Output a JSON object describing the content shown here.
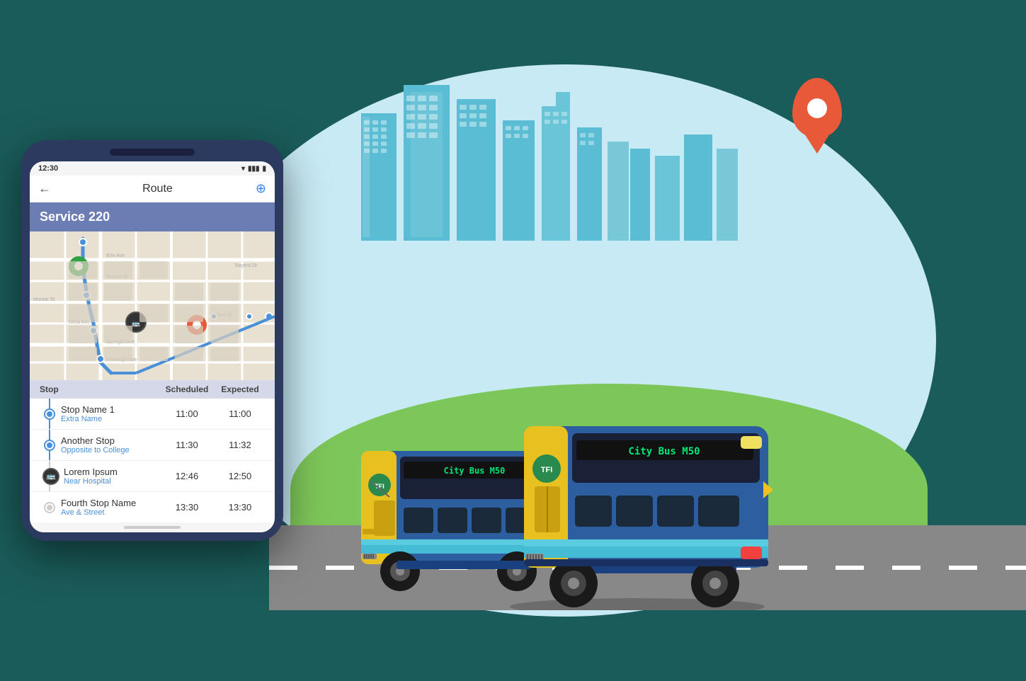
{
  "background_color": "#1a5c5a",
  "oval": {
    "bg_color": "#c8eaf5"
  },
  "hill": {
    "color": "#7dc65a"
  },
  "buses": [
    {
      "id": "bus1",
      "display_text": "City Bus M50",
      "tfi_label": "TFI"
    },
    {
      "id": "bus2",
      "display_text": "City Bus M50",
      "tfi_label": "TFI"
    }
  ],
  "phone": {
    "time": "12:30",
    "header_title": "Route",
    "service_name": "Service 220",
    "back_label": "←",
    "table_headers": {
      "stop": "Stop",
      "scheduled": "Scheduled",
      "expected": "Expected"
    },
    "stops": [
      {
        "name": "Stop Name 1",
        "extra": "Extra Name",
        "scheduled": "11:00",
        "expected": "11:00",
        "type": "dot",
        "color": "blue"
      },
      {
        "name": "Another Stop",
        "extra": "Opposite to College",
        "scheduled": "11:30",
        "expected": "11:32",
        "type": "dot",
        "color": "blue"
      },
      {
        "name": "Lorem Ipsum",
        "extra": "Near Hospital",
        "scheduled": "12:46",
        "expected": "12:50",
        "type": "bus",
        "color": "dark"
      },
      {
        "name": "Fourth Stop Name",
        "extra": "Ave & Street",
        "scheduled": "13:30",
        "expected": "13:30",
        "type": "dot",
        "color": "gray"
      }
    ]
  }
}
